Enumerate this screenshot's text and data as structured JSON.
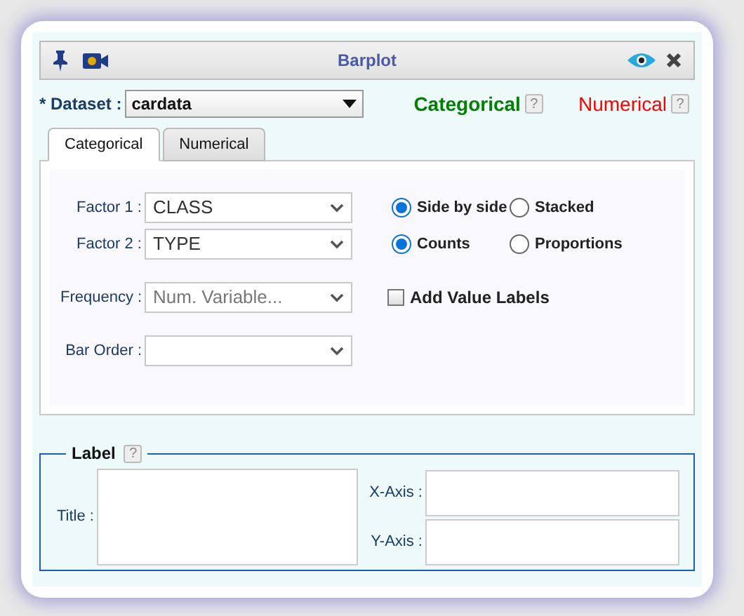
{
  "window": {
    "title": "Barplot"
  },
  "dataset": {
    "label": "* Dataset :",
    "value": "cardata"
  },
  "variable_types": [
    {
      "label": "Categorical",
      "help": "?",
      "color": "#008000"
    },
    {
      "label": "Numerical",
      "help": "?",
      "color": "#ff0000"
    }
  ],
  "tabs": [
    {
      "label": "Categorical",
      "selected": true
    },
    {
      "label": "Numerical",
      "selected": false
    }
  ],
  "fields": [
    {
      "label": "Factor 1 :",
      "value": "CLASS"
    },
    {
      "label": "Factor 2 :",
      "value": "TYPE"
    },
    {
      "label": "Frequency :",
      "placeholder": "Num. Variable..."
    },
    {
      "label": "Bar Order :"
    }
  ],
  "radio_groups": [
    [
      {
        "label": "Side by side",
        "selected": true
      },
      {
        "label": "Stacked",
        "selected": false
      }
    ],
    [
      {
        "label": "Counts",
        "selected": true
      },
      {
        "label": "Proportions",
        "selected": false
      }
    ]
  ],
  "value_labels": {
    "label": "Add Value Labels",
    "checked": false
  },
  "label_section": {
    "legend": "Label",
    "help": "?",
    "title_label": "Title :",
    "x_label": "X-Axis :",
    "y_label": "Y-Axis :"
  }
}
